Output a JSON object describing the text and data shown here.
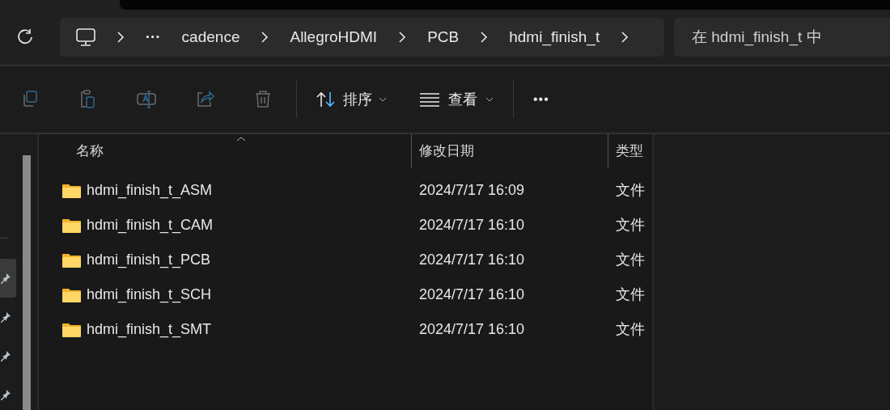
{
  "address_bar": {
    "breadcrumbs": [
      "cadence",
      "AllegroHDMI",
      "PCB",
      "hdmi_finish_t"
    ],
    "overflow": "···"
  },
  "search": {
    "placeholder": "在 hdmi_finish_t 中"
  },
  "toolbar": {
    "actions": [
      {
        "kind": "copy",
        "disabled": true
      },
      {
        "kind": "paste",
        "disabled": true
      },
      {
        "kind": "rename",
        "disabled": true
      },
      {
        "kind": "share",
        "disabled": true
      },
      {
        "kind": "delete",
        "disabled": true
      }
    ],
    "sort": "排序",
    "view": "查看",
    "more": "•••"
  },
  "sidebar": {
    "pins": [
      {
        "selected": true
      },
      {
        "selected": false
      },
      {
        "selected": false
      },
      {
        "selected": false
      }
    ]
  },
  "table": {
    "columns": [
      "名称",
      "修改日期",
      "类型"
    ],
    "rows": [
      {
        "name": "hdmi_finish_t_ASM",
        "modified": "2024/7/17 16:09",
        "type": "文件"
      },
      {
        "name": "hdmi_finish_t_CAM",
        "modified": "2024/7/17 16:10",
        "type": "文件"
      },
      {
        "name": "hdmi_finish_t_PCB",
        "modified": "2024/7/17 16:10",
        "type": "文件"
      },
      {
        "name": "hdmi_finish_t_SCH",
        "modified": "2024/7/17 16:10",
        "type": "文件"
      },
      {
        "name": "hdmi_finish_t_SMT",
        "modified": "2024/7/17 16:10",
        "type": "文件"
      }
    ]
  }
}
